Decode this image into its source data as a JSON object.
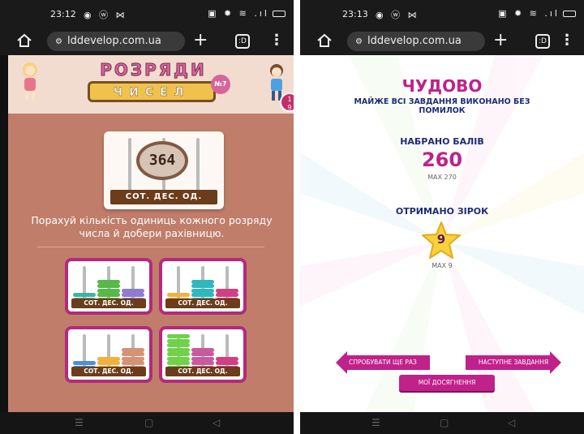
{
  "left_phone": {
    "status": {
      "time": "23:12",
      "icons_left": "◉ ⓦ ⋈",
      "icons_right": "▣ ✹ ≋ .ıl"
    },
    "browser": {
      "url": "lddevelop.com.ua",
      "tabs_count": ":D"
    },
    "game": {
      "logo_top": "РОЗРЯДИ",
      "logo_bottom": "ЧИСЕЛ",
      "logo_number": "№7",
      "progress": {
        "current": "1",
        "total": "9",
        "fraction": 0.111
      },
      "target_number": "364",
      "place_labels": "СОТ. ДЕС. ОД.",
      "instruction": "Порахуй кількість одиниць кожного розряду числа й добери рахівницю.",
      "choices": [
        {
          "beads": [
            3,
            6,
            4
          ],
          "colors": [
            "#42b3a0",
            "#58b848",
            "#8f7bd0"
          ],
          "label": "СОТ. ДЕС. ОД."
        },
        {
          "beads": [
            3,
            6,
            4
          ],
          "colors": [
            "#f0b23a",
            "#2fb7bd",
            "#d43f84"
          ],
          "label": "СОТ. ДЕС. ОД."
        },
        {
          "beads": [
            3,
            4,
            6
          ],
          "colors": [
            "#4a8fd9",
            "#f0b23a",
            "#d49276"
          ],
          "label": "СОТ. ДЕС. ОД."
        },
        {
          "beads": [
            9,
            6,
            4
          ],
          "colors": [
            "#6fd24a",
            "#c95a9f",
            "#d43f84"
          ],
          "label": "СОТ. ДЕС. ОД."
        }
      ]
    }
  },
  "right_phone": {
    "status": {
      "time": "23:13",
      "icons_left": "◉ ⓦ ⋈",
      "icons_right": "▣ ✹ ≋ .ıl"
    },
    "browser": {
      "url": "lddevelop.com.ua",
      "tabs_count": ":D"
    },
    "result": {
      "title": "ЧУДОВО",
      "subtitle": "МАЙЖЕ ВСІ ЗАВДАННЯ ВИКОНАНО БЕЗ ПОМИЛОК",
      "score_label": "НАБРАНО БАЛІВ",
      "score": "260",
      "score_max": "MAX 270",
      "stars_label": "ОТРИМАНО ЗІРОК",
      "stars": "9",
      "stars_max": "MAX 9",
      "retry_button": "СПРОБУВАТИ ЩЕ РАЗ",
      "next_button": "НАСТУПНЕ ЗАВДАННЯ",
      "achievements_button": "МОЇ ДОСЯГНЕННЯ"
    }
  },
  "colors": {
    "game_bg": "#c07d6a",
    "accent": "#c0218a",
    "navy": "#1e2b73",
    "star": "#f7d23a"
  }
}
